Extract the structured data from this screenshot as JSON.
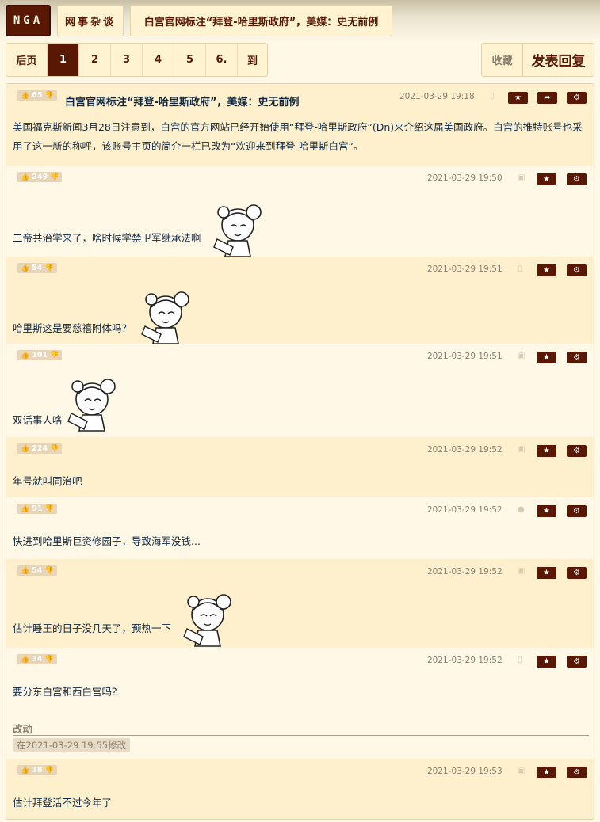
{
  "nav": {
    "logo": "NGA",
    "forum": "网事杂谈",
    "thread": "白宫官网标注“拜登-哈里斯政府”，美媒：史无前例"
  },
  "pager": {
    "prev": "后页",
    "pages": [
      "1",
      "2",
      "3",
      "4",
      "5",
      "6."
    ],
    "go": "到",
    "current": "1"
  },
  "actions": {
    "favorite": "收藏",
    "reply": "发表回复"
  },
  "icons": {
    "like": "thumbs-up-icon",
    "dislike": "thumbs-down-icon",
    "star": "star-icon",
    "share": "share-icon",
    "settings": "gear-icon"
  },
  "colors": {
    "accent": "#591804",
    "bg": "#fff8e7",
    "alt_bg": "#fff0cd"
  },
  "posts": [
    {
      "likes": "65",
      "title": "白宫官网标注“拜登-哈里斯政府”，美媒：史无前例",
      "date": "2021-03-29 19:18",
      "device": "phone-icon",
      "text": "美国福克斯新闻3月28日注意到，白宫的官方网站已经开始使用“拜登-哈里斯政府”(Ɖn)来介绍这届美国政府。白宫的推特账号也采用了这一新的称呼，该账号主页的简介一栏已改为“欢迎来到拜登-哈里斯白宫”。"
    },
    {
      "likes": "249",
      "date": "2021-03-29 19:50",
      "device": "android-icon",
      "text": "二帝共治学来了，啥时候学禁卫军继承法啊"
    },
    {
      "likes": "54",
      "date": "2021-03-29 19:51",
      "device": "phone-icon",
      "text": "哈里斯这是要慈禧附体吗？"
    },
    {
      "likes": "101",
      "date": "2021-03-29 19:51",
      "device": "android-icon",
      "text": "双话事人咯"
    },
    {
      "likes": "224",
      "date": "2021-03-29 19:52",
      "device": "android-icon",
      "text": "年号就叫同治吧"
    },
    {
      "likes": "91",
      "date": "2021-03-29 19:52",
      "device": "apple-icon",
      "text": "快进到哈里斯巨资修园子，导致海军没钱..."
    },
    {
      "likes": "54",
      "date": "2021-03-29 19:52",
      "device": "android-icon",
      "text": "估计睡王的日子没几天了，预热一下"
    },
    {
      "likes": "34",
      "date": "2021-03-29 19:52",
      "device": "phone-icon",
      "text": "要分东白宫和西白宫吗？",
      "edit_title": "改动",
      "edit_note": "在2021-03-29 19:55修改"
    },
    {
      "likes": "18",
      "date": "2021-03-29 19:53",
      "device": "android-icon",
      "text": "估计拜登活不过今年了"
    }
  ]
}
